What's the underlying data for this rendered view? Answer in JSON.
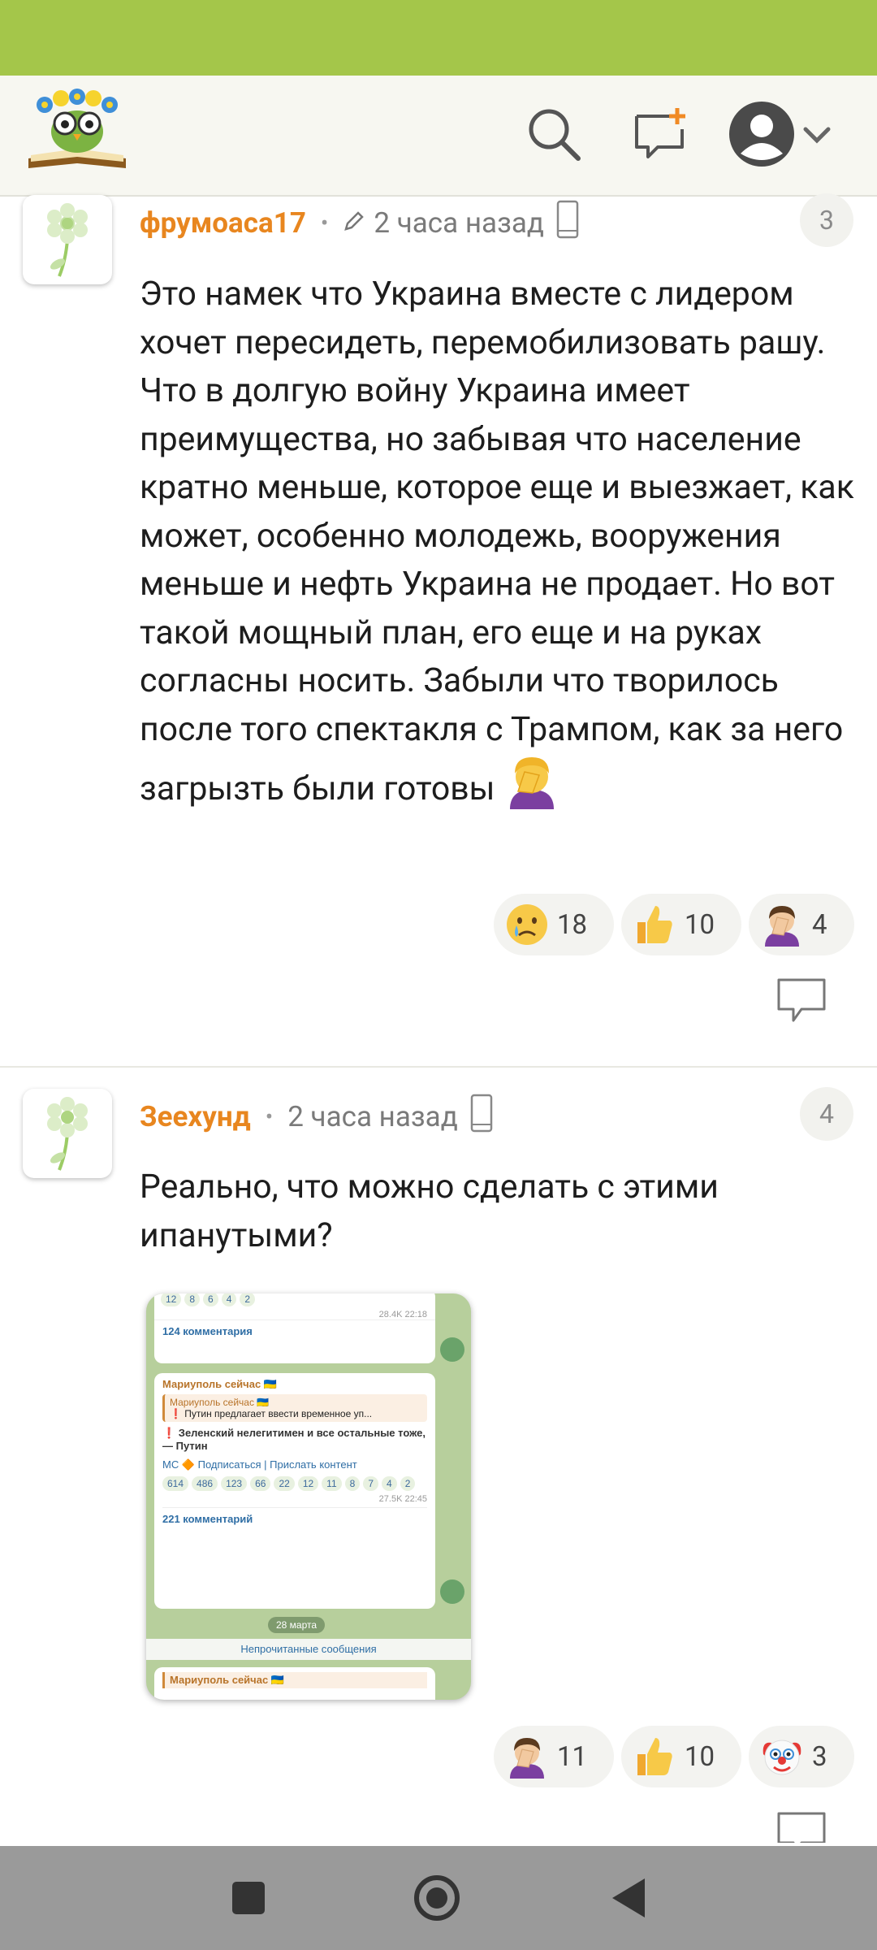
{
  "header": {
    "logo_icon": "owl-reading-book-logo",
    "search_icon": "search-icon",
    "new_message_icon": "new-message-icon",
    "profile_icon": "profile-avatar-icon"
  },
  "comments": [
    {
      "username": "фрумоаса17",
      "edited_icon": "pencil-icon",
      "time": "2 часа назад",
      "device_icon": "mobile-icon",
      "number": "3",
      "text": "Это намек что Украина вместе с лидером хочет пересидеть, перемобилизовать рашу. Что в долгую войну Украина имеет преимущества, но забывая что население кратно меньше, которое еще и выезжает, как может, особенно молодежь, вооружения меньше и нефть Украина не продает. Но вот такой мощный план, его еще и на руках согласны носить. Забыли что творилось после того спектакля с Трампом, как за него загрызть были готовы",
      "text_emoji": "facepalm-woman-emoji",
      "reactions": [
        {
          "emoji": "crying-face",
          "count": "18"
        },
        {
          "emoji": "thumbs-up",
          "count": "10"
        },
        {
          "emoji": "facepalm-woman",
          "count": "4"
        }
      ]
    },
    {
      "username": "Зеехунд",
      "time": "2 часа назад",
      "device_icon": "mobile-icon",
      "number": "4",
      "text": "Реально, что можно сделать с этими ипанутыми?",
      "reactions": [
        {
          "emoji": "facepalm-woman",
          "count": "11"
        },
        {
          "emoji": "thumbs-up",
          "count": "10"
        },
        {
          "emoji": "clown-face",
          "count": "3"
        }
      ],
      "attachment": {
        "top_reactions": [
          "12",
          "8",
          "6",
          "4",
          "2"
        ],
        "top_meta": "28.4K 22:18",
        "top_comments": "124 комментария",
        "channel": "Мариуполь сейчас 🇺🇦",
        "quote_channel": "Мариуполь сейчас 🇺🇦",
        "quote_text": "❗ Путин предлагает ввести временное уп...",
        "body": "❗ Зеленский нелегитимен и все остальные тоже, — Путин",
        "links": "МС 🔶 Подписаться | Прислать контент",
        "reactions": [
          "614",
          "486",
          "123",
          "66",
          "22",
          "12",
          "11",
          "8",
          "7",
          "4",
          "2"
        ],
        "meta": "27.5K 22:45",
        "comments": "221 комментарий",
        "date": "28 марта",
        "unread": "Непрочитанные сообщения",
        "next_channel": "Мариуполь сейчас 🇺🇦"
      }
    }
  ],
  "nav": {
    "recents_icon": "square-icon",
    "home_icon": "home-circle-icon",
    "back_icon": "back-triangle-icon"
  },
  "colors": {
    "status_bar": "#a4c64a",
    "username": "#e8861f",
    "nav_bar": "#9a9a9a"
  }
}
